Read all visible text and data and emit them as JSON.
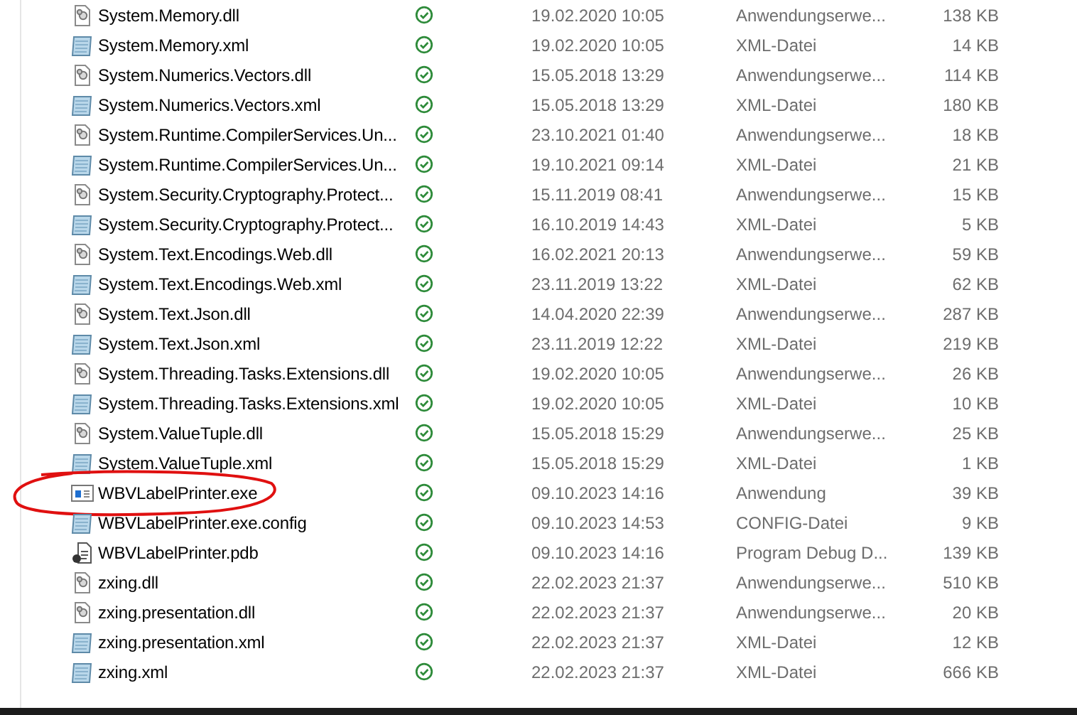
{
  "files": [
    {
      "name": "System.Memory.dll",
      "kind": "dll",
      "synced": true,
      "date": "19.02.2020 10:05",
      "type": "Anwendungserwe...",
      "size": "138 KB",
      "circled": false
    },
    {
      "name": "System.Memory.xml",
      "kind": "xml",
      "synced": true,
      "date": "19.02.2020 10:05",
      "type": "XML-Datei",
      "size": "14 KB",
      "circled": false
    },
    {
      "name": "System.Numerics.Vectors.dll",
      "kind": "dll",
      "synced": true,
      "date": "15.05.2018 13:29",
      "type": "Anwendungserwe...",
      "size": "114 KB",
      "circled": false
    },
    {
      "name": "System.Numerics.Vectors.xml",
      "kind": "xml",
      "synced": true,
      "date": "15.05.2018 13:29",
      "type": "XML-Datei",
      "size": "180 KB",
      "circled": false
    },
    {
      "name": "System.Runtime.CompilerServices.Un...",
      "kind": "dll",
      "synced": true,
      "date": "23.10.2021 01:40",
      "type": "Anwendungserwe...",
      "size": "18 KB",
      "circled": false
    },
    {
      "name": "System.Runtime.CompilerServices.Un...",
      "kind": "xml",
      "synced": true,
      "date": "19.10.2021 09:14",
      "type": "XML-Datei",
      "size": "21 KB",
      "circled": false
    },
    {
      "name": "System.Security.Cryptography.Protect...",
      "kind": "dll",
      "synced": true,
      "date": "15.11.2019 08:41",
      "type": "Anwendungserwe...",
      "size": "15 KB",
      "circled": false
    },
    {
      "name": "System.Security.Cryptography.Protect...",
      "kind": "xml",
      "synced": true,
      "date": "16.10.2019 14:43",
      "type": "XML-Datei",
      "size": "5 KB",
      "circled": false
    },
    {
      "name": "System.Text.Encodings.Web.dll",
      "kind": "dll",
      "synced": true,
      "date": "16.02.2021 20:13",
      "type": "Anwendungserwe...",
      "size": "59 KB",
      "circled": false
    },
    {
      "name": "System.Text.Encodings.Web.xml",
      "kind": "xml",
      "synced": true,
      "date": "23.11.2019 13:22",
      "type": "XML-Datei",
      "size": "62 KB",
      "circled": false
    },
    {
      "name": "System.Text.Json.dll",
      "kind": "dll",
      "synced": true,
      "date": "14.04.2020 22:39",
      "type": "Anwendungserwe...",
      "size": "287 KB",
      "circled": false
    },
    {
      "name": "System.Text.Json.xml",
      "kind": "xml",
      "synced": true,
      "date": "23.11.2019 12:22",
      "type": "XML-Datei",
      "size": "219 KB",
      "circled": false
    },
    {
      "name": "System.Threading.Tasks.Extensions.dll",
      "kind": "dll",
      "synced": true,
      "date": "19.02.2020 10:05",
      "type": "Anwendungserwe...",
      "size": "26 KB",
      "circled": false
    },
    {
      "name": "System.Threading.Tasks.Extensions.xml",
      "kind": "xml",
      "synced": true,
      "date": "19.02.2020 10:05",
      "type": "XML-Datei",
      "size": "10 KB",
      "circled": false
    },
    {
      "name": "System.ValueTuple.dll",
      "kind": "dll",
      "synced": true,
      "date": "15.05.2018 15:29",
      "type": "Anwendungserwe...",
      "size": "25 KB",
      "circled": false
    },
    {
      "name": "System.ValueTuple.xml",
      "kind": "xml",
      "synced": true,
      "date": "15.05.2018 15:29",
      "type": "XML-Datei",
      "size": "1 KB",
      "circled": false
    },
    {
      "name": "WBVLabelPrinter.exe",
      "kind": "exe",
      "synced": true,
      "date": "09.10.2023 14:16",
      "type": "Anwendung",
      "size": "39 KB",
      "circled": true
    },
    {
      "name": "WBVLabelPrinter.exe.config",
      "kind": "xml",
      "synced": true,
      "date": "09.10.2023 14:53",
      "type": "CONFIG-Datei",
      "size": "9 KB",
      "circled": false
    },
    {
      "name": "WBVLabelPrinter.pdb",
      "kind": "pdb",
      "synced": true,
      "date": "09.10.2023 14:16",
      "type": "Program Debug D...",
      "size": "139 KB",
      "circled": false
    },
    {
      "name": "zxing.dll",
      "kind": "dll",
      "synced": true,
      "date": "22.02.2023 21:37",
      "type": "Anwendungserwe...",
      "size": "510 KB",
      "circled": false
    },
    {
      "name": "zxing.presentation.dll",
      "kind": "dll",
      "synced": true,
      "date": "22.02.2023 21:37",
      "type": "Anwendungserwe...",
      "size": "20 KB",
      "circled": false
    },
    {
      "name": "zxing.presentation.xml",
      "kind": "xml",
      "synced": true,
      "date": "22.02.2023 21:37",
      "type": "XML-Datei",
      "size": "12 KB",
      "circled": false
    },
    {
      "name": "zxing.xml",
      "kind": "xml",
      "synced": true,
      "date": "22.02.2023 21:37",
      "type": "XML-Datei",
      "size": "666 KB",
      "circled": false
    }
  ]
}
